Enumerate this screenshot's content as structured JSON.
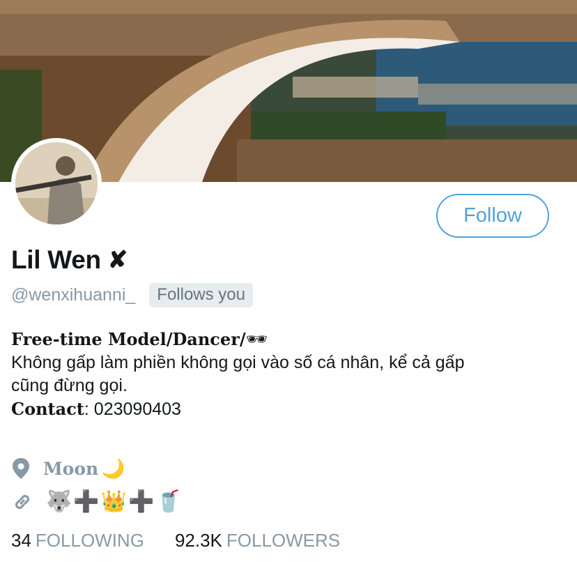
{
  "profile": {
    "follow_label": "Follow",
    "display_name": "Lil Wen",
    "name_mark": "✘",
    "handle": "@wenxihuanni_",
    "follows_you": "Follows you"
  },
  "bio": {
    "line1_bold": "Free-time Model/Dancer/",
    "line1_emoji": "🕶",
    "line2": "Không gấp làm phiền không gọi vào số cá nhân, kể cả gấp",
    "line3": "cũng đừng gọi.",
    "contact_label": "Contact",
    "contact_value": ": 023090403"
  },
  "meta": {
    "location": "Moon",
    "location_emoji": "🌙",
    "link_text": "🐺➕👑➕🥤",
    "location_icon": "location-pin-icon",
    "link_icon": "link-icon"
  },
  "stats": {
    "following_count": "34",
    "following_label": "FOLLOWING",
    "followers_count": "92.3K",
    "followers_label": "FOLLOWERS"
  },
  "colors": {
    "accent": "#4fa1e0",
    "muted": "#8899a6"
  }
}
